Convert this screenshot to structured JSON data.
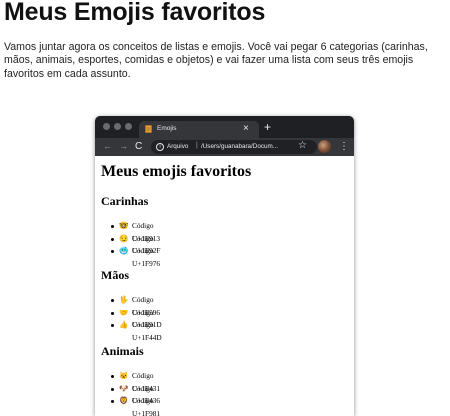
{
  "document": {
    "title": "Meus Emojis favoritos",
    "intro": "Vamos juntar agora os conceitos de listas e emojis. Você vai pegar 6 categorias (carinhas, mãos, animais, esportes, comidas e objetos) e vai fazer uma lista com seus três emojis favoritos em cada assunto."
  },
  "browser": {
    "tab_title": "Emojis",
    "tab_icon": "document-icon",
    "tab_close": "×",
    "new_tab": "+",
    "toolbar": {
      "back": "←",
      "forward": "→",
      "reload": "C"
    },
    "address": {
      "info": "i",
      "prefix": "Arquivo",
      "separator": "|",
      "path": "/Users/guanabara/Docum..."
    },
    "star": "☆",
    "menu": "⋮",
    "colors": {
      "titlebar": "#1f2023",
      "tab": "#35363a",
      "toolbar": "#35363a",
      "omnibox": "#202124"
    }
  },
  "page": {
    "heading": "Meus emojis favoritos",
    "sections": [
      {
        "title": "Carinhas",
        "items": [
          {
            "emoji": "🤓",
            "code": "Código U+1F913"
          },
          {
            "emoji": "😏",
            "code": "Código U+1F92F"
          },
          {
            "emoji": "🥶",
            "code": "Código U+1F976"
          }
        ]
      },
      {
        "title": "Mãos",
        "items": [
          {
            "emoji": "🖖",
            "code": "Código U+1F596"
          },
          {
            "emoji": "🤝",
            "code": "Código U+1F91D"
          },
          {
            "emoji": "👍",
            "code": "Código U+1F44D"
          }
        ]
      },
      {
        "title": "Animais",
        "items": [
          {
            "emoji": "🐱",
            "code": "Código U+1F431"
          },
          {
            "emoji": "🐶",
            "code": "Código U+1F436"
          },
          {
            "emoji": "🦁",
            "code": "Código U+1F981"
          }
        ]
      }
    ]
  }
}
